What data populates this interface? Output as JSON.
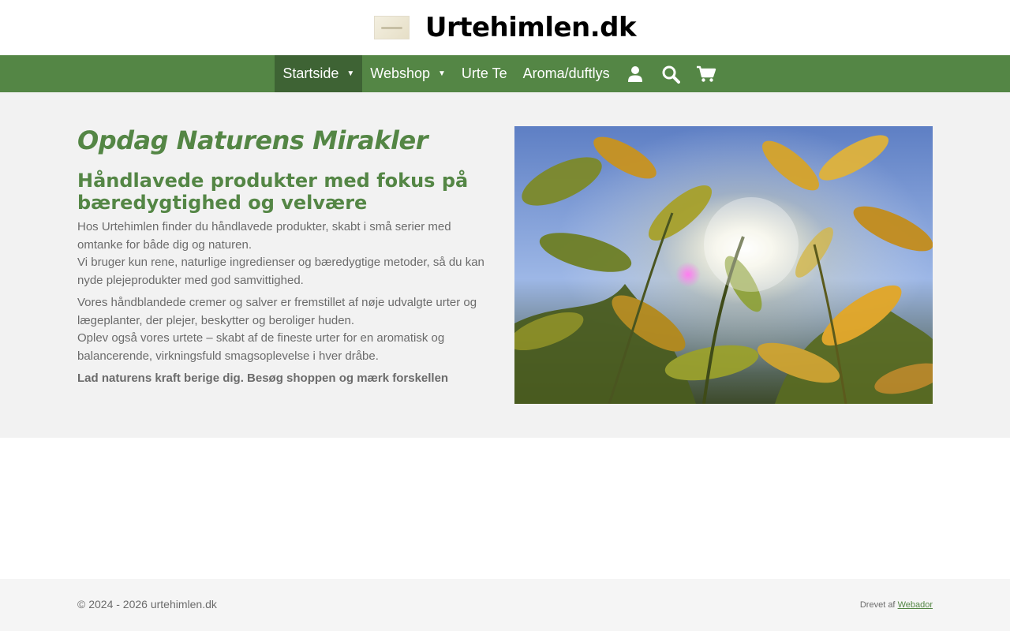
{
  "header": {
    "logo_icon": "urtehimlen-logo",
    "title": "Urtehimlen.dk"
  },
  "nav": {
    "items": [
      {
        "label": "Startside",
        "has_dropdown": true,
        "active": true
      },
      {
        "label": "Webshop",
        "has_dropdown": true,
        "active": false
      },
      {
        "label": "Urte Te",
        "has_dropdown": false,
        "active": false
      },
      {
        "label": "Aroma/duftlys",
        "has_dropdown": false,
        "active": false
      }
    ],
    "dropdown_caret": "▼",
    "icons": [
      "user-icon",
      "search-icon",
      "cart-icon"
    ],
    "bar_color": "#548645",
    "active_color": "#3e6334"
  },
  "main": {
    "headline": "Opdag Naturens Mirakler",
    "subheadline": "Håndlavede produkter med fokus på bæredygtighed og velvære",
    "paragraphs": [
      {
        "line1": "Hos Urtehimlen finder du håndlavede produkter, skabt i små serier med omtanke for både dig og naturen.",
        "line2": "Vi bruger kun rene, naturlige ingredienser og bæredygtige metoder, så du kan nyde plejeprodukter med god samvittighed."
      },
      {
        "line1": "Vores håndblandede cremer og salver er fremstillet af nøje udvalgte urter og lægeplanter, der plejer, beskytter og beroliger huden.",
        "line2": "Oplev også vores urtete – skabt af de fineste urter for en aromatisk og balancerende, virkningsfuld smagsoplevelse i hver dråbe."
      }
    ],
    "call_to_action": "Lad naturens kraft berige dig. Besøg shoppen og mærk forskellen",
    "accent_color": "#548645"
  },
  "footer": {
    "copyright": "© 2024 - 2026 urtehimlen.dk",
    "powered_prefix": "Drevet af",
    "powered_link": "Webador"
  }
}
